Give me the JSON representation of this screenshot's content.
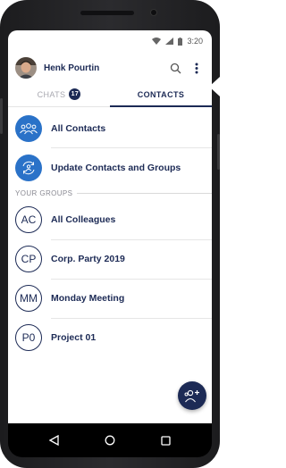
{
  "status_bar": {
    "time": "3:20"
  },
  "header": {
    "user_name": "Henk Pourtin"
  },
  "tabs": [
    {
      "label": "CHATS",
      "badge": "17"
    },
    {
      "label": "CONTACTS"
    }
  ],
  "actions": [
    {
      "label": "All Contacts",
      "icon": "people-group-icon"
    },
    {
      "label": "Update Contacts and Groups",
      "icon": "sync-contacts-icon"
    }
  ],
  "groups_section": {
    "header": "YOUR GROUPS",
    "items": [
      {
        "initials": "AC",
        "name": "All Colleagues"
      },
      {
        "initials": "CP",
        "name": "Corp. Party 2019"
      },
      {
        "initials": "MM",
        "name": "Monday Meeting"
      },
      {
        "initials": "P0",
        "name": "Project 01"
      }
    ]
  },
  "colors": {
    "navy": "#1c2a55",
    "accent_blue": "#2a72c8"
  }
}
